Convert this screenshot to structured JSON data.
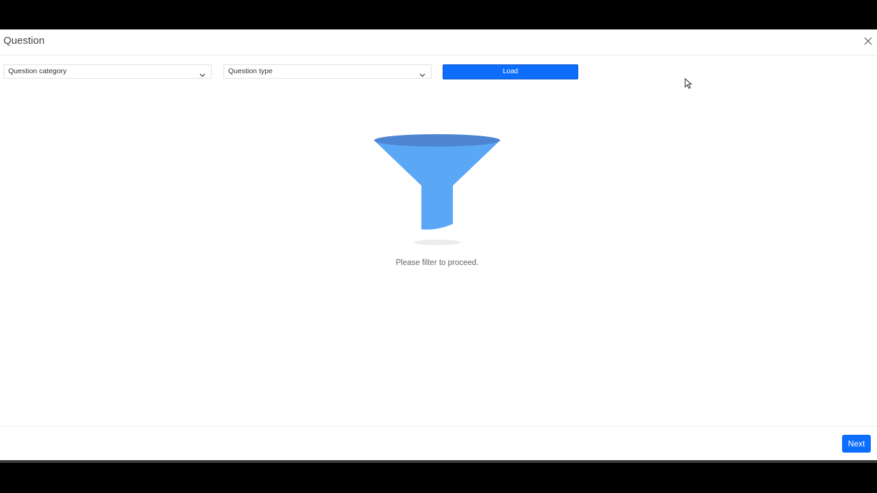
{
  "modal": {
    "title": "Question"
  },
  "filters": {
    "category_placeholder": "Question category",
    "type_placeholder": "Question type",
    "load_label": "Load"
  },
  "empty_state": {
    "message": "Please filter to proceed."
  },
  "footer": {
    "next_label": "Next"
  },
  "icons": {
    "close": "close-icon",
    "chevron": "chevron-down-icon",
    "illustration": "funnel-icon",
    "cursor": "mouse-pointer-icon"
  },
  "colors": {
    "primary": "#0d6efd",
    "funnel_light": "#5aa7f5",
    "funnel_dark": "#4d85d3"
  }
}
